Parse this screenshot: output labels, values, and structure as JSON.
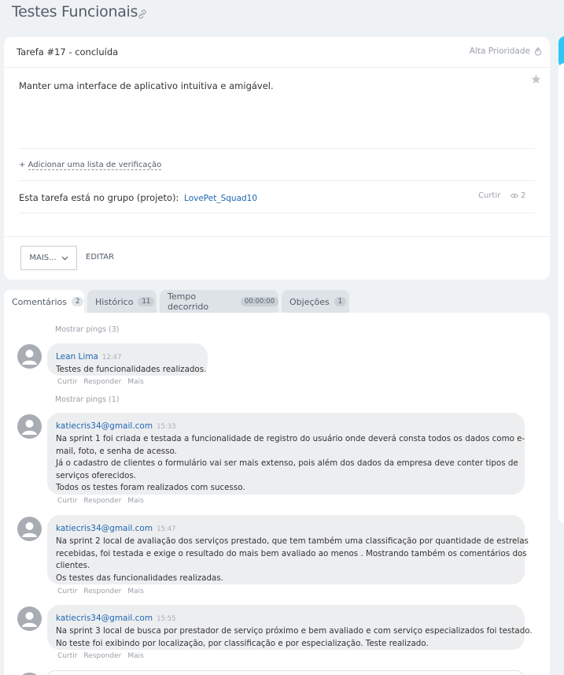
{
  "page": {
    "title": "Testes Funcionais"
  },
  "task": {
    "header_title": "Tarefa #17 - concluída",
    "priority_label": "Alta Prioridade",
    "description": "Manter uma interface de aplicativo intuitiva e amigável.",
    "checklist_prefix": "+",
    "checklist_link": "Adicionar uma lista de verificação",
    "group_text": "Esta tarefa está no grupo (projeto):",
    "group_name": "LovePet_Squad10",
    "like_label": "Curtir",
    "views_count": "2",
    "more_button": "MAIS...",
    "edit_button": "EDITAR"
  },
  "tabs": [
    {
      "label": "Comentários",
      "count": "2"
    },
    {
      "label": "Histórico",
      "count": "11"
    },
    {
      "label": "Tempo decorrido",
      "count": "00:00:00"
    },
    {
      "label": "Objeções",
      "count": "1"
    }
  ],
  "comment_actions": {
    "like": "Curtir",
    "reply": "Responder",
    "more": "Mais"
  },
  "comments": [
    {
      "pings": "Mostrar pings (3)",
      "author": "Lean Lima",
      "time": "12:47",
      "lines": [
        "Testes de funcionalidades realizados."
      ]
    },
    {
      "pings": "Mostrar pings (1)",
      "author": "katiecris34@gmail.com",
      "time": "15:33",
      "lines": [
        "Na sprint 1 foi criada e testada a funcionalidade de registro do usuário onde deverá consta todos os dados como e-",
        "mail, foto, e senha de acesso.",
        "Já o cadastro de clientes o formulário vai ser mais extenso, pois além dos dados da empresa deve conter tipos de",
        "serviços oferecidos.",
        "Todos  os testes foram realizados com sucesso."
      ]
    },
    {
      "pings": "",
      "author": "katiecris34@gmail.com",
      "time": "15:47",
      "lines": [
        "Na sprint 2 local de avaliação dos serviços prestado, que tem também uma classificação por quantidade de estrelas",
        "recebidas, foi testada e exige o resultado do mais bem avaliado ao menos . Mostrando também os comentários dos",
        "clientes.",
        "Os testes das funcionalidades realizadas."
      ]
    },
    {
      "pings": "",
      "author": "katiecris34@gmail.com",
      "time": "15:55",
      "lines": [
        "Na sprint 3 local de busca por prestador de serviço próximo e bem avaliado e  com serviço especializados foi testado.",
        "No teste foi exibindo por localização, por classificação e por especialização. Teste realizado."
      ]
    }
  ]
}
